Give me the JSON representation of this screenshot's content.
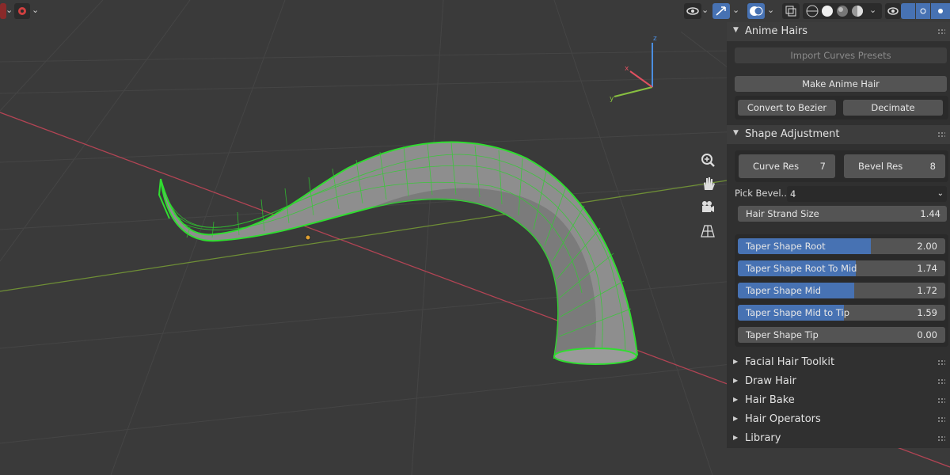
{
  "viewport": {
    "gizmo_axis": {
      "x": "x",
      "y": "y",
      "z": "z"
    },
    "colors": {
      "background": "#3a3a3a",
      "x_axis": "#c04858",
      "y_axis": "#7fa33a",
      "selection": "#22dd22",
      "accent": "#4772b3"
    }
  },
  "header": {
    "icons": [
      "select-icon",
      "overlay-eye-icon",
      "gizmo-icon",
      "viewport-shading-icon",
      "xray-icon",
      "solid-shading-icon",
      "material-preview-icon",
      "rendered-icon"
    ]
  },
  "nav_buttons": [
    "zoom-icon",
    "pan-hand-icon",
    "camera-icon",
    "grid-view-icon"
  ],
  "panel": {
    "anime_hairs": {
      "title": "Anime Hairs",
      "import_presets": "Import Curves Presets",
      "make_anime_hair": "Make Anime Hair",
      "convert_to_bezier": "Convert to Bezier",
      "decimate": "Decimate"
    },
    "shape_adjustment": {
      "title": "Shape Adjustment",
      "curve_res_label": "Curve Res",
      "curve_res_value": "7",
      "bevel_res_label": "Bevel Res",
      "bevel_res_value": "8",
      "pick_bevel_label": "Pick Bevel...",
      "pick_bevel_value": "4",
      "strand_size_label": "Hair Strand Size",
      "strand_size_value": "1.44",
      "tapers": [
        {
          "label": "Taper Shape Root",
          "value": "2.00",
          "fill": 0.64
        },
        {
          "label": "Taper Shape Root To Mid",
          "value": "1.74",
          "fill": 0.57
        },
        {
          "label": "Taper Shape Mid",
          "value": "1.72",
          "fill": 0.56
        },
        {
          "label": "Taper Shape Mid to Tip",
          "value": "1.59",
          "fill": 0.51
        },
        {
          "label": "Taper Shape Tip",
          "value": "0.00",
          "fill": 0.0
        }
      ]
    },
    "collapsed_sections": [
      "Facial Hair Toolkit",
      "Draw Hair",
      "Hair Bake",
      "Hair Operators",
      "Library"
    ]
  }
}
